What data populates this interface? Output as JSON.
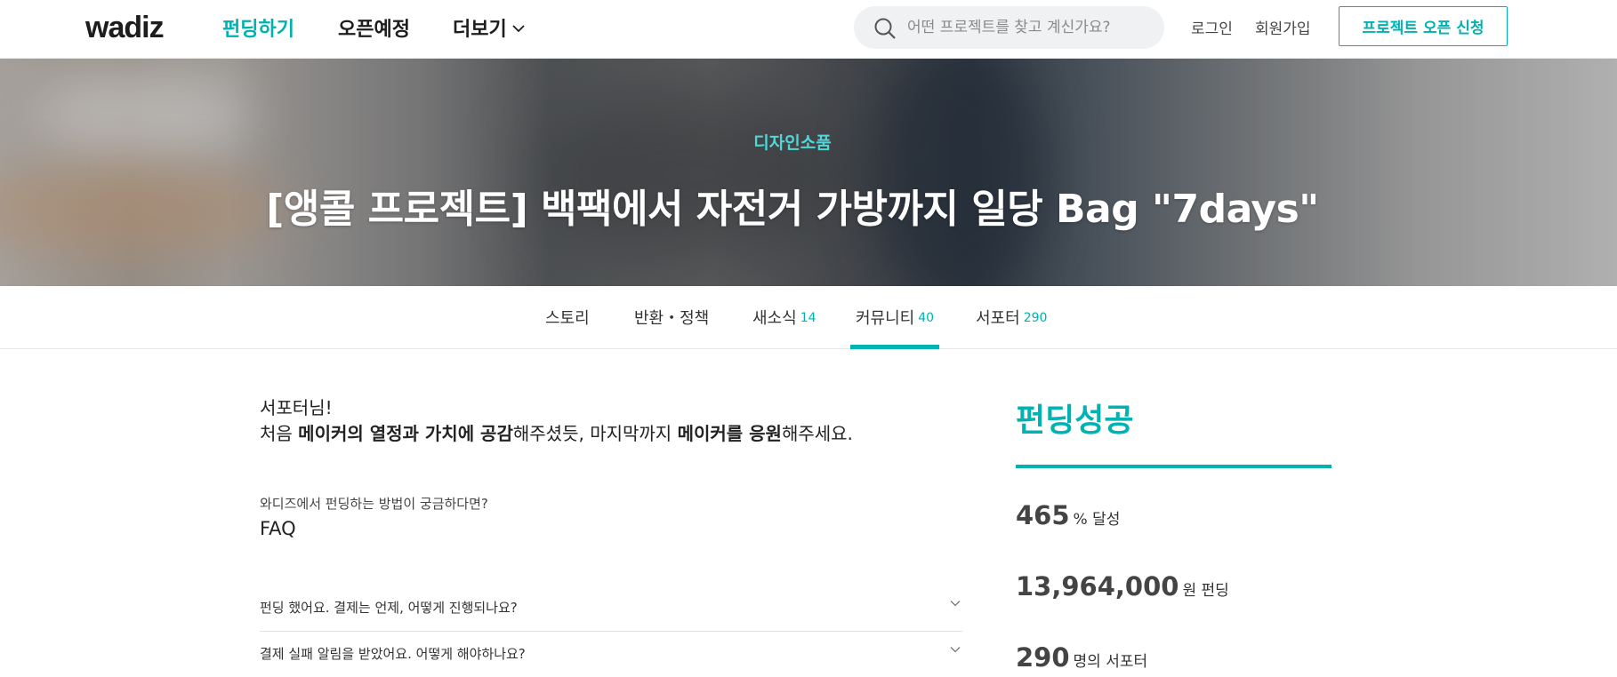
{
  "header": {
    "logo": "wadiz",
    "nav": [
      "펀딩하기",
      "오픈예정",
      "더보기"
    ],
    "search_placeholder": "어떤 프로젝트를 찾고 계신가요?",
    "login": "로그인",
    "signup": "회원가입",
    "open_project": "프로젝트 오픈 신청",
    "accent_color": "#00b2b2"
  },
  "hero": {
    "category": "디자인소품",
    "title": "[앵콜 프로젝트] 백팩에서 자전거 가방까지 일당 Bag \"7days\""
  },
  "tabs": [
    {
      "label": "스토리",
      "count": ""
    },
    {
      "label": "반환・정책",
      "count": ""
    },
    {
      "label": "새소식",
      "count": "14"
    },
    {
      "label": "커뮤니티",
      "count": "40",
      "active": true
    },
    {
      "label": "서포터",
      "count": "290"
    }
  ],
  "main": {
    "greeting_line1": "서포터님!",
    "greeting_line2": {
      "p1": "처음 ",
      "b1": "메이커의 열정과 가치에 공감",
      "p2": "해주셨듯, 마지막까지 ",
      "b2": "메이커를 응원",
      "p3": "해주세요."
    },
    "faq_hint": "와디즈에서 펀딩하는 방법이 궁금하다면?",
    "faq_title": "FAQ",
    "faq_items": [
      "펀딩 했어요. 결제는 언제, 어떻게 진행되나요?",
      "결제 실패 알림을 받았어요. 어떻게 해야하나요?"
    ]
  },
  "side": {
    "status": "펀딩성공",
    "achievement_value": "465",
    "achievement_unit": "% 달성",
    "amount_value": "13,964,000",
    "amount_unit": "원 펀딩",
    "supporters_value": "290",
    "supporters_unit": "명의 서포터"
  }
}
